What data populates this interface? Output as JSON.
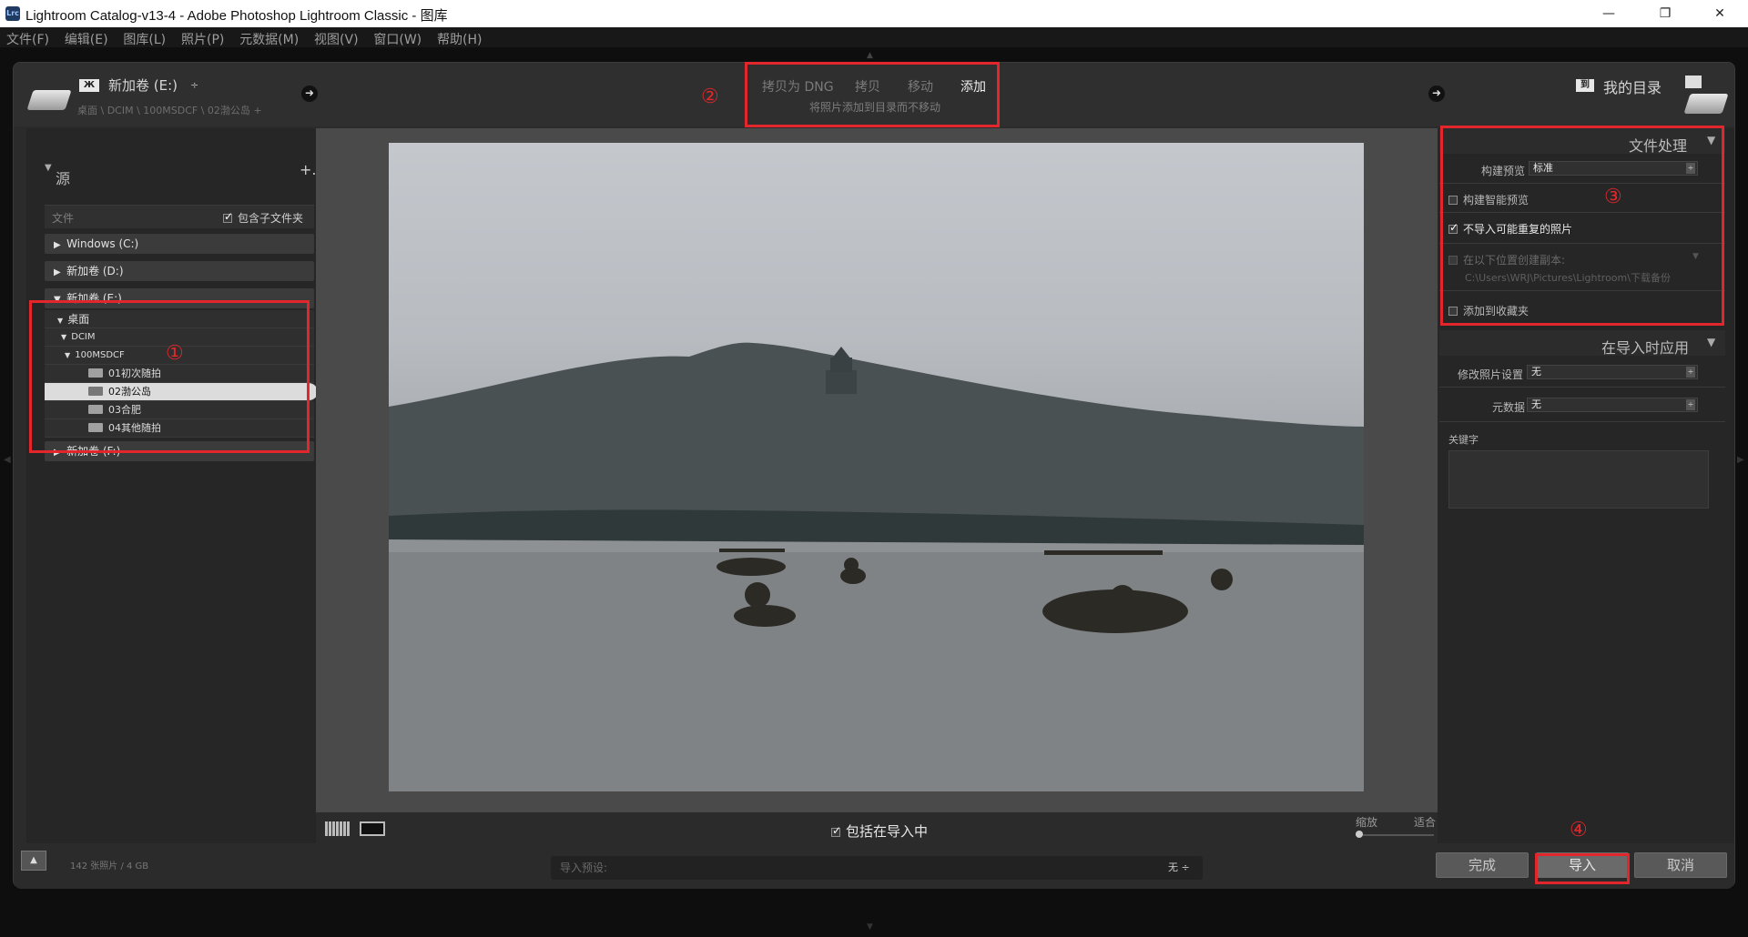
{
  "window": {
    "title": "Lightroom Catalog-v13-4 - Adobe Photoshop Lightroom Classic - 图库",
    "app_icon": "Lrc",
    "minimize": "—",
    "restore": "❐",
    "close": "✕"
  },
  "menu": [
    "文件(F)",
    "编辑(E)",
    "图库(L)",
    "照片(P)",
    "元数据(M)",
    "视图(V)",
    "窗口(W)",
    "帮助(H)"
  ],
  "top": {
    "source_name": "新加卷 (E:)",
    "source_path": "桌面 \\ DCIM \\ 100MSDCF \\ 02渤公岛 +",
    "modes": [
      "拷贝为 DNG",
      "拷贝",
      "移动",
      "添加"
    ],
    "active_mode": "添加",
    "mode_subtitle": "将照片添加到目录而不移动",
    "destination": "我的目录",
    "dest_badge": "到"
  },
  "left": {
    "source_header": "源",
    "add": "+.",
    "files_label": "文件",
    "include_subfolders": "包含子文件夹",
    "drives": [
      "Windows (C:)",
      "新加卷 (D:)",
      "新加卷 (E:)",
      "新加卷 (F:)"
    ],
    "tree": {
      "desktop": "桌面",
      "dcim": "DCIM",
      "folder100": "100MSDCF",
      "folders": [
        "01初次随拍",
        "02渤公岛",
        "03合肥",
        "04其他随拍"
      ]
    },
    "footer": "142 张照片 / 4 GB"
  },
  "center": {
    "include_in_import": "包括在导入中",
    "zoom_label": "缩放",
    "fit_label": "适合",
    "preset_label": "导入预设:",
    "preset_value": "无 ÷"
  },
  "right": {
    "file_handling": "文件处理",
    "build_previews_label": "构建预览",
    "build_previews_value": "标准",
    "smart_previews": "构建智能预览",
    "dont_import_duplicates": "不导入可能重复的照片",
    "second_copy": "在以下位置创建副本:",
    "second_copy_path": "C:\\Users\\WRJ\\Pictures\\Lightroom\\下载备份",
    "add_to_collection": "添加到收藏夹",
    "apply_during_import": "在导入时应用",
    "develop_settings_label": "修改照片设置",
    "develop_settings_value": "无",
    "metadata_label": "元数据",
    "metadata_value": "无",
    "keywords_label": "关键字"
  },
  "buttons": {
    "done": "完成",
    "import": "导入",
    "cancel": "取消"
  },
  "annotations": [
    "①",
    "②",
    "③",
    "④"
  ]
}
